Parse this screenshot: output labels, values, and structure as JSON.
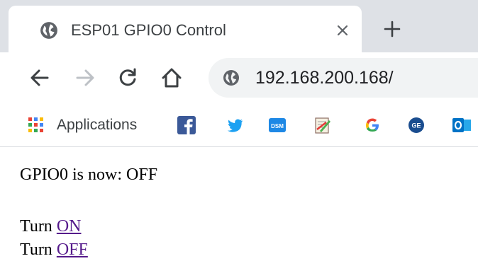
{
  "tab": {
    "title": "ESP01 GPIO0 Control",
    "favicon": "globe-icon"
  },
  "toolbar": {
    "url": "192.168.200.168/",
    "site_info_icon": "globe-icon"
  },
  "bookmarks": {
    "apps_label": "Applications",
    "items": [
      {
        "name": "facebook-icon",
        "color": "#3b5998"
      },
      {
        "name": "twitter-icon",
        "color": "#1da1f2"
      },
      {
        "name": "dsm-icon",
        "color": "#1e88e5"
      },
      {
        "name": "notepad-icon",
        "color": "#4caf50"
      },
      {
        "name": "google-icon",
        "color": "#4285f4"
      },
      {
        "name": "ge-icon",
        "color": "#1a4d8f"
      },
      {
        "name": "outlook-icon",
        "color": "#0072c6"
      }
    ]
  },
  "page": {
    "status_text": "GPIO0 is now: OFF",
    "turn_prefix": "Turn",
    "on_link": "ON",
    "off_link": "OFF"
  }
}
